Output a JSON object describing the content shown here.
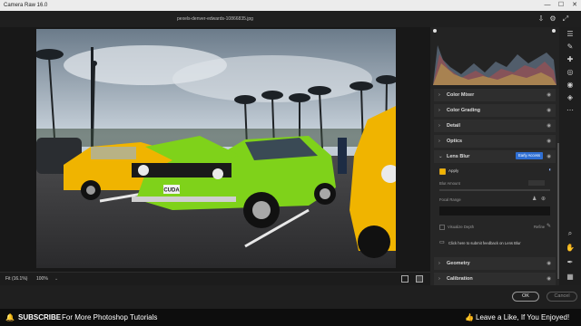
{
  "window": {
    "title": "Camera Raw 16.0",
    "minimize": "—",
    "maximize": "☐",
    "close": "✕"
  },
  "file": {
    "name": "pexels-denver-edwards-10866835.jpg"
  },
  "image": {
    "plate": "CUDA"
  },
  "bottom": {
    "fit": "Fit (16.1%)",
    "zoom": "100%",
    "zoom_dropdown": "⌄"
  },
  "panel": {
    "sections": [
      {
        "label": "Color Mixer",
        "chev": "›"
      },
      {
        "label": "Color Grading",
        "chev": "›"
      },
      {
        "label": "Detail",
        "chev": "›"
      },
      {
        "label": "Optics",
        "chev": "›"
      },
      {
        "label": "Lens Blur",
        "chev": "⌄"
      }
    ],
    "lens_blur": {
      "badge": "Early Access",
      "apply_label": "Apply",
      "blur_amount_label": "Blur Amount",
      "focal_range_label": "Focal Range",
      "visualize_depth_label": "Visualize Depth",
      "refine_label": "Refine",
      "feedback_text": "Click here to submit feedback on Lens Blur"
    },
    "lower_sections": [
      {
        "label": "Geometry",
        "chev": "›"
      },
      {
        "label": "Calibration",
        "chev": "›"
      }
    ]
  },
  "footer": {
    "ok": "OK",
    "cancel": "Cancel"
  },
  "banner": {
    "subscribe": "SUBSCRIBE",
    "subscribe_rest": "For More Photoshop Tutorials",
    "like": "Leave a Like, If You Enjoyed!"
  },
  "colors": {
    "accent": "#2f6fd3",
    "panel_bg": "#262626",
    "section_bg": "#2e2e2e",
    "car_green": "#7fd21a",
    "car_yellow": "#f0b400"
  },
  "icons": {
    "top_tools": [
      "save-icon",
      "settings-icon",
      "expand-icon"
    ],
    "strip": [
      "edit-sliders-icon",
      "brush-icon",
      "healing-icon",
      "mask-icon",
      "red-eye-icon",
      "presets-icon",
      "more-icon",
      "zoom-icon",
      "hand-icon",
      "eyedropper-icon",
      "grid-icon"
    ]
  }
}
